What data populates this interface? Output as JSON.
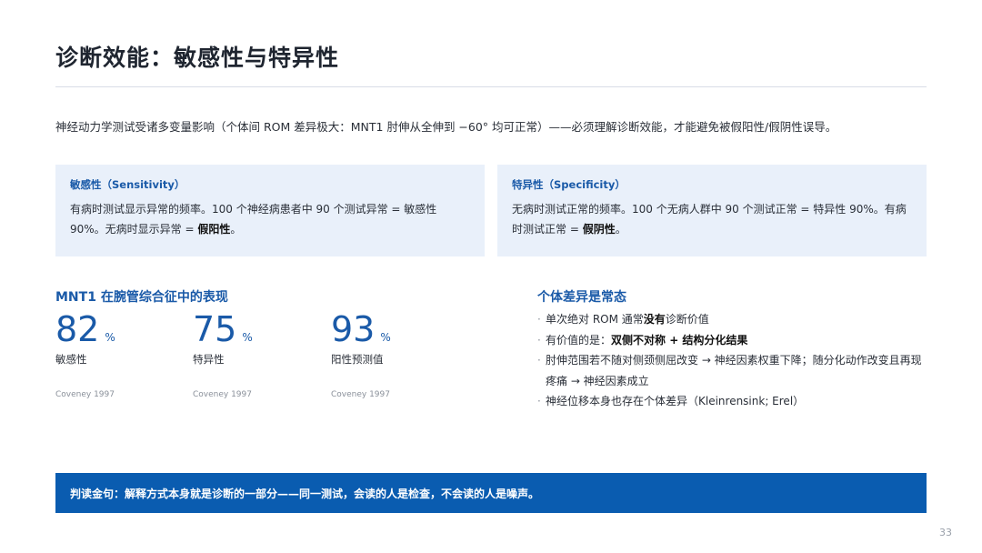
{
  "slide": {
    "title": "诊断效能：敏感性与特异性",
    "intro": "神经动力学测试受诸多变量影响（个体间 ROM 差异极大：MNT1 肘伸从全伸到 −60° 均可正常）——必须理解诊断效能，才能避免被假阳性/假阴性误导。",
    "page_number": "33"
  },
  "definitions": {
    "sensitivity": {
      "title": "敏感性（Sensitivity）",
      "body": "有病时测试显示异常的频率。100 个神经病患者中 90 个测试异常 = 敏感性 90%。无病时显示异常 = ",
      "emphasis": "假阳性",
      "end": "。"
    },
    "specificity": {
      "title": "特异性（Specificity）",
      "body": "无病时测试正常的频率。100 个无病人群中 90 个测试正常 = 特异性 90%。有病时测试正常 = ",
      "emphasis": "假阴性",
      "end": "。"
    }
  },
  "mnt1": {
    "heading": "MNT1 在腕管综合征中的表现",
    "unit": "%",
    "stats": [
      {
        "value": "82",
        "unit": "%",
        "label": "敏感性",
        "source": "Coveney 1997"
      },
      {
        "value": "75",
        "unit": "%",
        "label": "特异性",
        "source": "Coveney 1997"
      },
      {
        "value": "93",
        "unit": "%",
        "label": "阳性预测值",
        "source": "Coveney 1997"
      }
    ]
  },
  "variation": {
    "heading": "个体差异是常态",
    "bullet_marker": "·",
    "bullets": [
      {
        "before": "单次绝对 ROM 通常",
        "bold": "没有",
        "after": "诊断价值"
      },
      {
        "before": "有价值的是：",
        "bold": "双侧不对称 + 结构分化结果",
        "after": ""
      },
      {
        "before": "肘伸范围若不随对侧颈侧屈改变 → 神经因素权重下降；随分化动作改变且再现疼痛 → 神经因素成立",
        "bold": "",
        "after": ""
      },
      {
        "before": "神经位移本身也存在个体差异（Kleinrensink; Erel）",
        "bold": "",
        "after": ""
      }
    ]
  },
  "banner": {
    "text": "判读金句：解释方式本身就是诊断的一部分——同一测试，会读的人是检查，不会读的人是噪声。"
  },
  "colors": {
    "accent": "#1a5aa8",
    "banner_bg": "#0a5cb0",
    "card_bg": "#e9f0fa"
  }
}
